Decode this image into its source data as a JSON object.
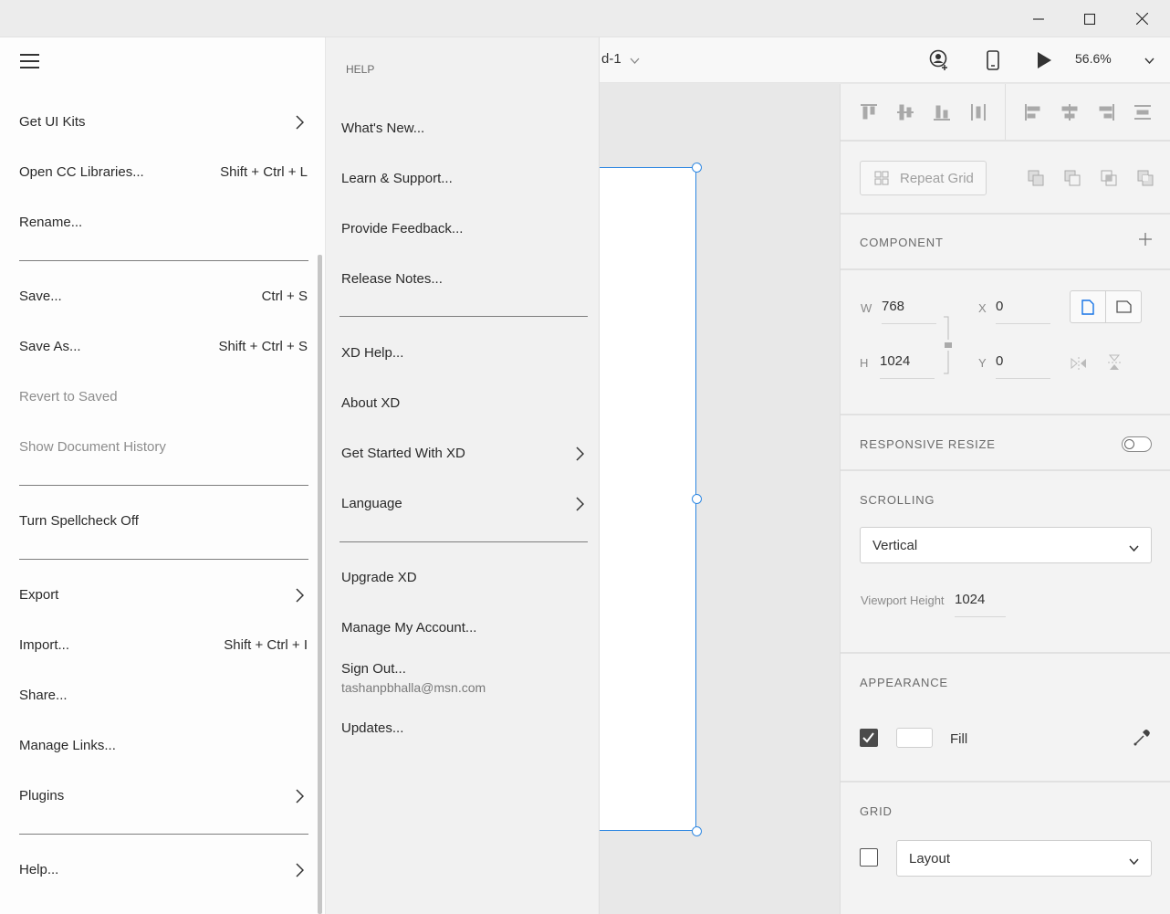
{
  "window": {
    "controls": [
      "minimize-icon",
      "maximize-icon",
      "close-icon"
    ]
  },
  "toolbar": {
    "doc_title": "d-1",
    "zoom": "56.6%"
  },
  "main_menu": {
    "items": [
      {
        "label": "Get UI Kits",
        "shortcut": "",
        "submenu": true,
        "disabled": false
      },
      {
        "label": "Open CC Libraries...",
        "shortcut": "Shift + Ctrl + L",
        "submenu": false,
        "disabled": false
      },
      {
        "label": "Rename...",
        "shortcut": "",
        "submenu": false,
        "disabled": false
      },
      {
        "label": "Save...",
        "shortcut": "Ctrl + S",
        "submenu": false,
        "disabled": false
      },
      {
        "label": "Save As...",
        "shortcut": "Shift + Ctrl + S",
        "submenu": false,
        "disabled": false
      },
      {
        "label": "Revert to Saved",
        "shortcut": "",
        "submenu": false,
        "disabled": true
      },
      {
        "label": "Show Document History",
        "shortcut": "",
        "submenu": false,
        "disabled": true
      },
      {
        "label": "Turn Spellcheck Off",
        "shortcut": "",
        "submenu": false,
        "disabled": false
      },
      {
        "label": "Export",
        "shortcut": "",
        "submenu": true,
        "disabled": false
      },
      {
        "label": "Import...",
        "shortcut": "Shift + Ctrl + I",
        "submenu": false,
        "disabled": false
      },
      {
        "label": "Share...",
        "shortcut": "",
        "submenu": false,
        "disabled": false
      },
      {
        "label": "Manage Links...",
        "shortcut": "",
        "submenu": false,
        "disabled": false
      },
      {
        "label": "Plugins",
        "shortcut": "",
        "submenu": true,
        "disabled": false
      },
      {
        "label": "Help...",
        "shortcut": "",
        "submenu": true,
        "disabled": false
      }
    ]
  },
  "help_menu": {
    "heading": "HELP",
    "items": [
      {
        "label": "What's New..."
      },
      {
        "label": "Learn & Support..."
      },
      {
        "label": "Provide Feedback..."
      },
      {
        "label": "Release Notes..."
      },
      {
        "label": "XD Help..."
      },
      {
        "label": "About XD"
      },
      {
        "label": "Get Started With XD",
        "submenu": true
      },
      {
        "label": "Language",
        "submenu": true
      },
      {
        "label": "Upgrade XD"
      },
      {
        "label": "Manage My Account..."
      },
      {
        "label": "Sign Out...",
        "email": "tashanpbhalla@msn.com"
      },
      {
        "label": "Updates..."
      }
    ]
  },
  "properties": {
    "repeat_grid_label": "Repeat Grid",
    "component_title": "COMPONENT",
    "w_label": "W",
    "w_value": "768",
    "h_label": "H",
    "h_value": "1024",
    "x_label": "X",
    "x_value": "0",
    "y_label": "Y",
    "y_value": "0",
    "responsive_title": "RESPONSIVE RESIZE",
    "responsive_on": false,
    "scrolling_title": "SCROLLING",
    "scrolling_value": "Vertical",
    "viewport_label": "Viewport Height",
    "viewport_value": "1024",
    "appearance_title": "APPEARANCE",
    "fill_label": "Fill",
    "fill_checked": true,
    "fill_color": "#ffffff",
    "grid_title": "GRID",
    "grid_checked": false,
    "grid_value": "Layout"
  },
  "colors": {
    "selection": "#2d87e2",
    "accent": "#1473e6"
  }
}
